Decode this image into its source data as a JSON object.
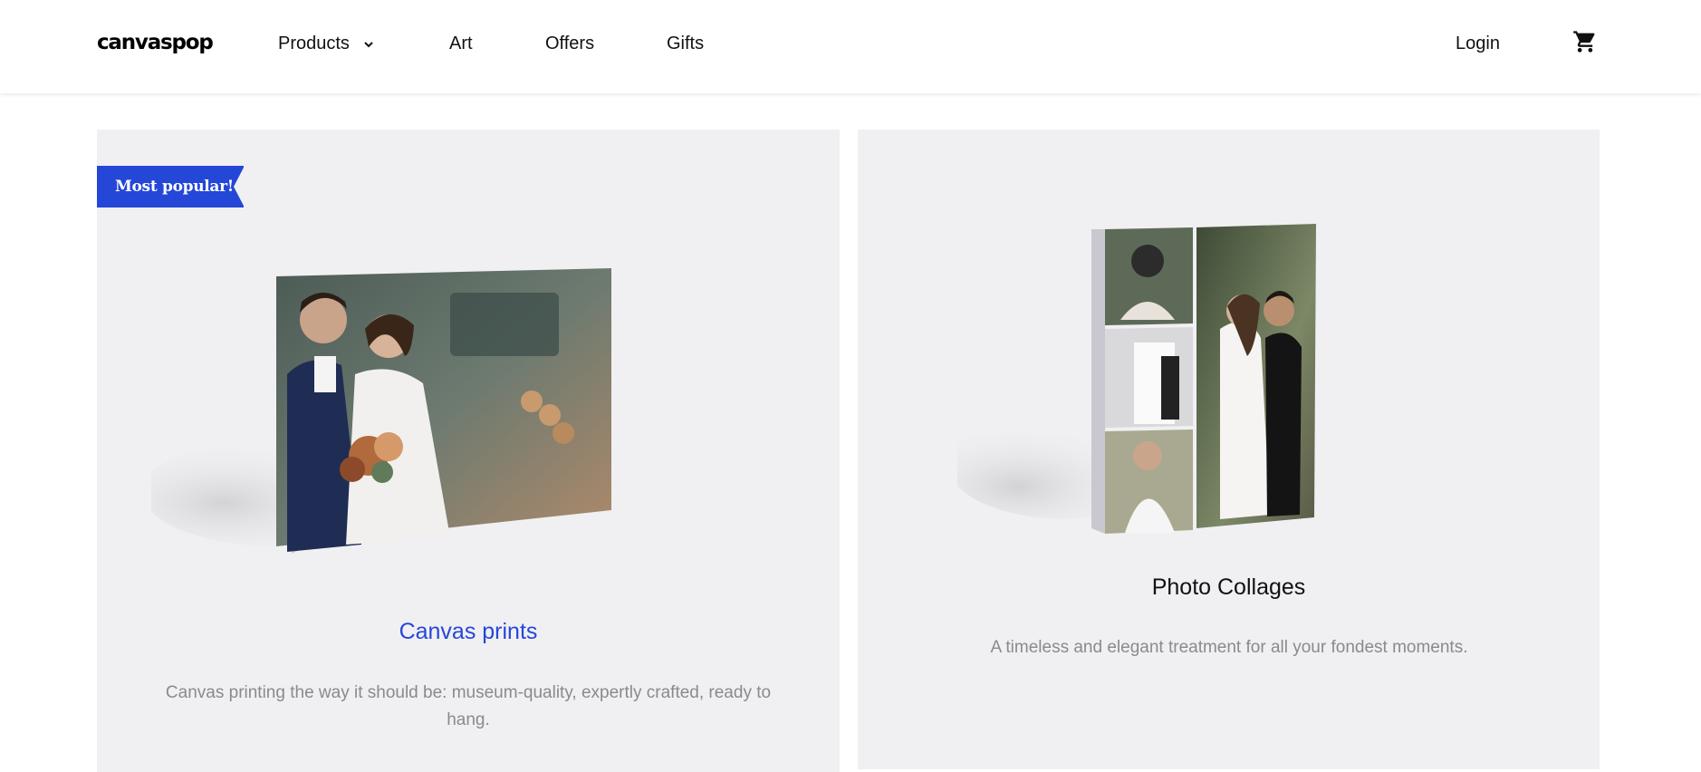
{
  "header": {
    "logo": "canvaspop",
    "nav": {
      "products": "Products",
      "art": "Art",
      "offers": "Offers",
      "gifts": "Gifts"
    },
    "login": "Login",
    "icons": {
      "products_dropdown": "chevron-down-icon",
      "cart": "shopping-cart-icon"
    }
  },
  "cards": [
    {
      "badge": "Most popular!",
      "title": "Canvas prints",
      "description": "Canvas printing the way it should be: museum-quality, expertly crafted, ready to hang.",
      "image": "wedding-couple-canvas-print"
    },
    {
      "title": "Photo Collages",
      "description": "A timeless and elegant treatment for all your fondest moments.",
      "image": "wedding-photo-collage-canvas"
    }
  ],
  "colors": {
    "accent": "#2447d8",
    "card_background": "#f0f0f2",
    "muted_text": "#8a8a8e"
  }
}
